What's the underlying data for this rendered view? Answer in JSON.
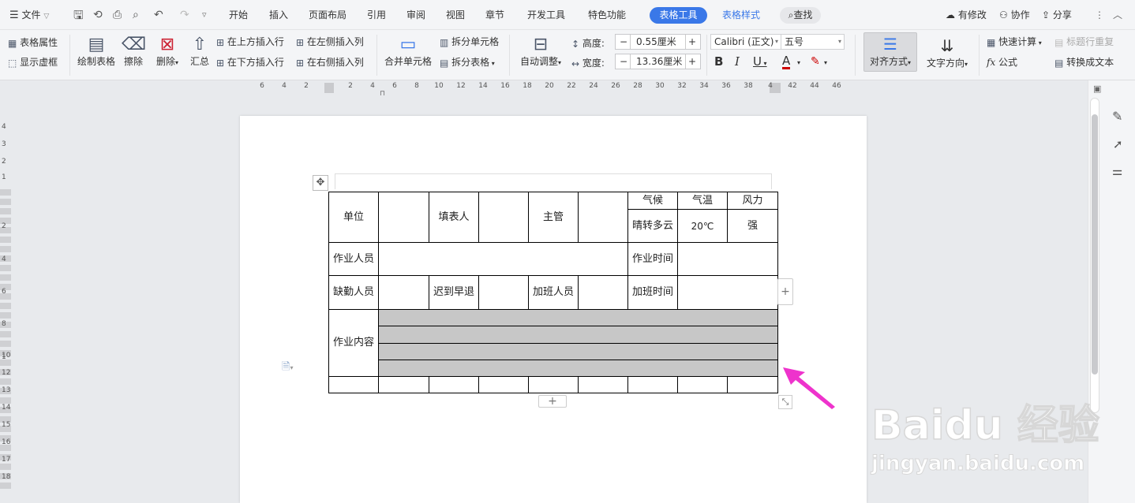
{
  "tabbar": {
    "file": "文件",
    "tabs": [
      "开始",
      "插入",
      "页面布局",
      "引用",
      "审阅",
      "视图",
      "章节",
      "开发工具",
      "特色功能"
    ],
    "table_tools": "表格工具",
    "table_style": "表格样式",
    "search": "查找",
    "modified": "有修改",
    "collab": "协作",
    "share": "分享"
  },
  "ribbon": {
    "table_props": "表格属性",
    "show_grid": "显示虚框",
    "draw_table": "绘制表格",
    "erase": "擦除",
    "delete": "删除",
    "summary": "汇总",
    "insert_above": "在上方插入行",
    "insert_below": "在下方插入行",
    "insert_left": "在左侧插入列",
    "insert_right": "在右侧插入列",
    "merge_cells": "合并单元格",
    "split_cells": "拆分单元格",
    "split_table": "拆分表格",
    "auto_adjust": "自动调整",
    "height_label": "高度:",
    "height_value": "0.55厘米",
    "width_label": "宽度:",
    "width_value": "13.36厘米",
    "font_name": "Calibri (正文)",
    "font_size": "五号",
    "align_mode": "对齐方式",
    "text_dir": "文字方向",
    "quick_calc": "快速计算",
    "formula": "公式",
    "repeat_header": "标题行重复",
    "to_text": "转换成文本",
    "bold": "B",
    "italic": "I",
    "underline": "U",
    "font_color": "A",
    "fx": "fx"
  },
  "ruler": {
    "h_ticks": [
      "6",
      "4",
      "2",
      "2",
      "4",
      "6",
      "8",
      "10",
      "12",
      "14",
      "16",
      "18",
      "20",
      "22",
      "24",
      "26",
      "28",
      "30",
      "32",
      "34",
      "36",
      "38",
      "4",
      "42",
      "44",
      "46"
    ],
    "v_ticks": [
      "4",
      "3",
      "2",
      "1",
      "2",
      "4",
      "6",
      "8",
      "10",
      "1",
      "12",
      "13",
      "14",
      "15",
      "16",
      "17",
      "18"
    ]
  },
  "table": {
    "r1": {
      "unit": "单位",
      "filler": "填表人",
      "manager": "主管",
      "weather": "气候",
      "temp": "气温",
      "wind": "风力"
    },
    "r2": {
      "weather_val": "晴转多云",
      "temp_val": "20℃",
      "wind_val": "强"
    },
    "r3": {
      "worker": "作业人员",
      "work_time": "作业时间"
    },
    "r4": {
      "absent": "缺勤人员",
      "late": "迟到早退",
      "overtime_person": "加班人员",
      "overtime_time": "加班时间"
    },
    "r5": {
      "content": "作业内容"
    }
  },
  "controls": {
    "add": "+"
  },
  "watermark": {
    "brand": "Baidu 经验",
    "url": "jingyan.baidu.com"
  },
  "colors": {
    "accent": "#3a78e8",
    "arrow": "#ee33cc",
    "shade": "#c7c7c7"
  }
}
